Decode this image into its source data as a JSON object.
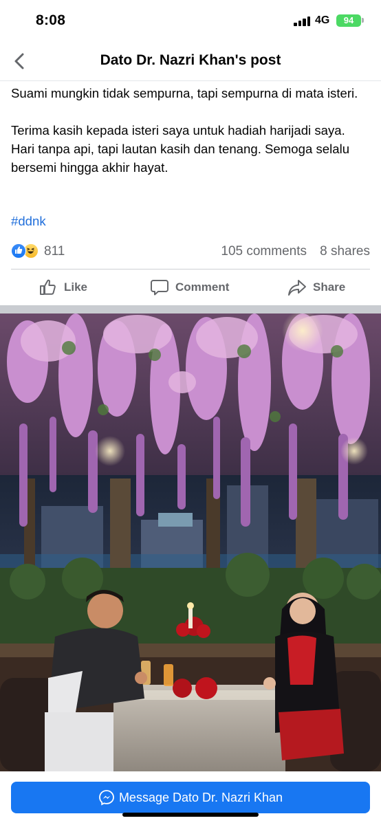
{
  "status_bar": {
    "time": "8:08",
    "network": "4G",
    "battery": "94"
  },
  "header": {
    "title": "Dato Dr. Nazri Khan's post",
    "back_icon": "chevron-left-icon"
  },
  "post": {
    "paragraph_1": "Suami mungkin tidak sempurna, tapi sempurna di mata isteri.",
    "paragraph_2": "Terima kasih kepada isteri saya untuk hadiah harijadi saya. Hari tanpa api, tapi lautan kasih dan tenang. Semoga selalu bersemi hingga akhir hayat.",
    "hashtag": "#ddnk"
  },
  "engagement": {
    "reaction_icons": [
      "like-reaction-icon",
      "haha-reaction-icon"
    ],
    "reaction_count": "811",
    "comments": "105 comments",
    "shares": "8 shares"
  },
  "actions": {
    "like": "Like",
    "comment": "Comment",
    "share": "Share"
  },
  "footer": {
    "message_button": "Message Dato Dr. Nazri Khan",
    "messenger_icon": "messenger-icon"
  },
  "colors": {
    "accent": "#1877f2",
    "hashtag": "#216fdb",
    "muted_text": "#65676b",
    "battery": "#4cd964"
  }
}
